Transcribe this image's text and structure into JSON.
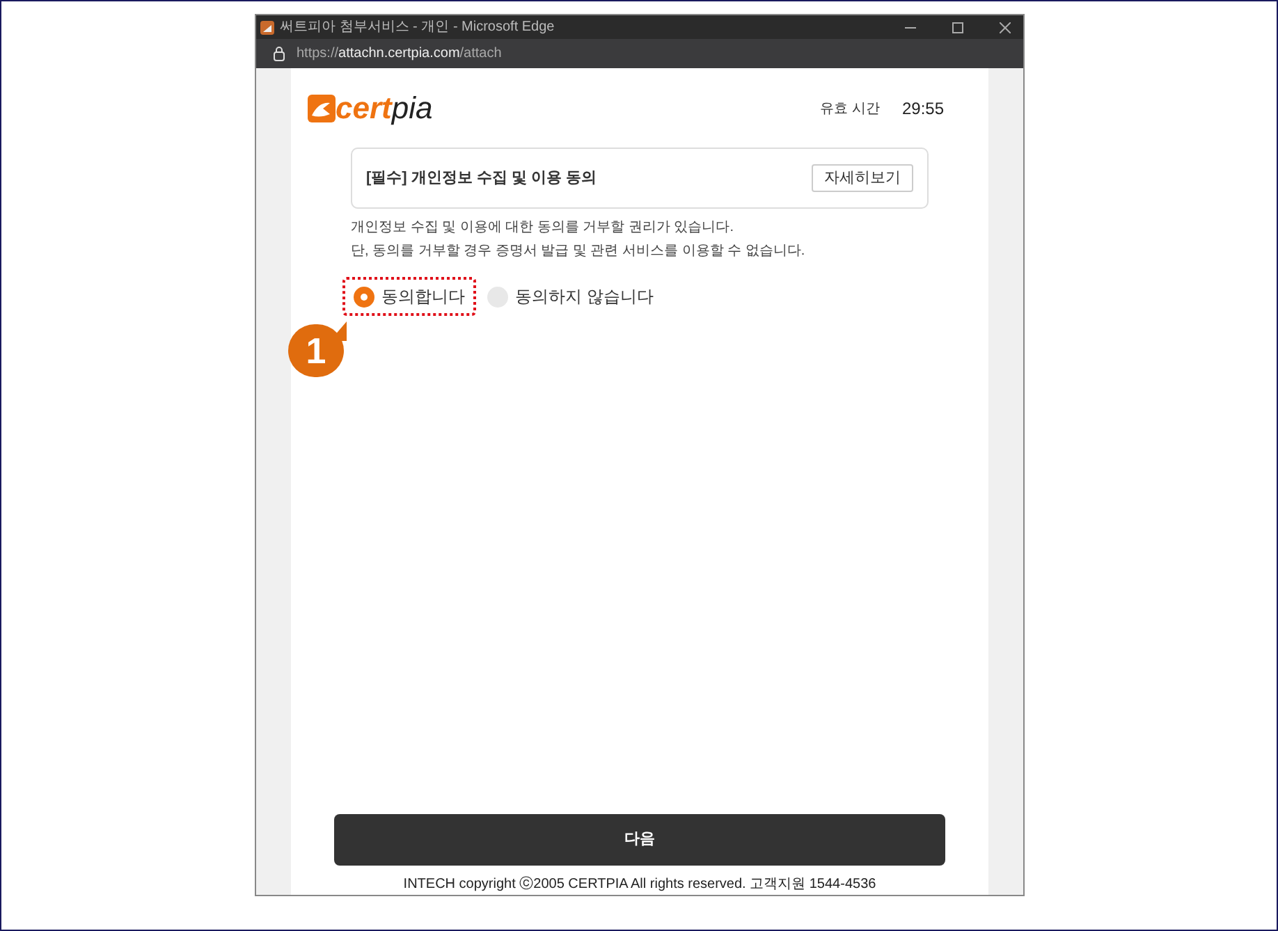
{
  "window": {
    "title": "써트피아 첨부서비스 - 개인 - Microsoft Edge",
    "url_prefix": "https://",
    "url_host": "attachn.certpia.com",
    "url_path": "/attach"
  },
  "header": {
    "logo_main": "cert",
    "logo_tail": "pia",
    "timer_label": "유효 시간",
    "timer": "29:55"
  },
  "consent": {
    "title": "[필수] 개인정보 수집 및 이용 동의",
    "details_button": "자세히보기",
    "notice": [
      "개인정보 수집 및 이용에 대한 동의를 거부할 권리가 있습니다.",
      "단, 동의를 거부할 경우 증명서 발급 및 관련 서비스를 이용할 수 없습니다."
    ],
    "options": [
      {
        "label": "동의합니다",
        "selected": true,
        "highlighted": true
      },
      {
        "label": "동의하지 않습니다",
        "selected": false,
        "highlighted": false
      }
    ]
  },
  "callout": {
    "label": "1"
  },
  "next_button": "다음",
  "footer": "INTECH copyright ⓒ2005 CERTPIA All rights reserved. 고객지원 1544-4536"
}
